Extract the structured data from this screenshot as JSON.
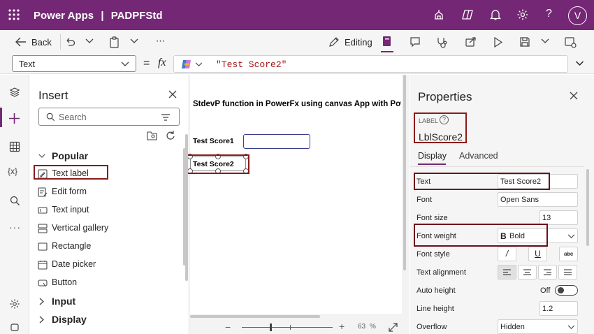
{
  "app": {
    "product": "Power Apps",
    "separator": "|",
    "app_name": "PADPFStd",
    "avatar_initial": "V"
  },
  "command_bar": {
    "back_label": "Back",
    "more_label": "⋯",
    "editing_label": "Editing"
  },
  "formula_bar": {
    "property": "Text",
    "equals": "=",
    "fx": "fx",
    "formula": "\"Test Score2\""
  },
  "insert_panel": {
    "title": "Insert",
    "search_placeholder": "Search",
    "group_popular": "Popular",
    "items": [
      "Text label",
      "Edit form",
      "Text input",
      "Vertical gallery",
      "Rectangle",
      "Date picker",
      "Button"
    ],
    "group_input": "Input",
    "group_display": "Display"
  },
  "canvas": {
    "title": "StdevP function in PowerFx using canvas App with Power apps",
    "label1": "Test Score1",
    "label2": "Test Score2",
    "zoom_value": "63",
    "zoom_unit": "%"
  },
  "properties": {
    "title": "Properties",
    "type_label": "LABEL",
    "control_name": "LblScore2",
    "tab_display": "Display",
    "tab_advanced": "Advanced",
    "rows": {
      "text": {
        "label": "Text",
        "value": "Test Score2"
      },
      "font": {
        "label": "Font",
        "value": "Open Sans"
      },
      "font_size": {
        "label": "Font size",
        "value": "13"
      },
      "font_weight": {
        "label": "Font weight",
        "value": "Bold",
        "value_icon": "B"
      },
      "font_style": {
        "label": "Font style",
        "italic": "/",
        "underline": "U",
        "strike": "abc"
      },
      "text_alignment": {
        "label": "Text alignment"
      },
      "auto_height": {
        "label": "Auto height",
        "value": "Off"
      },
      "line_height": {
        "label": "Line height",
        "value": "1.2"
      },
      "overflow": {
        "label": "Overflow",
        "value": "Hidden"
      }
    }
  },
  "colors": {
    "brand": "#742774",
    "highlight": "#8b1a1a"
  }
}
